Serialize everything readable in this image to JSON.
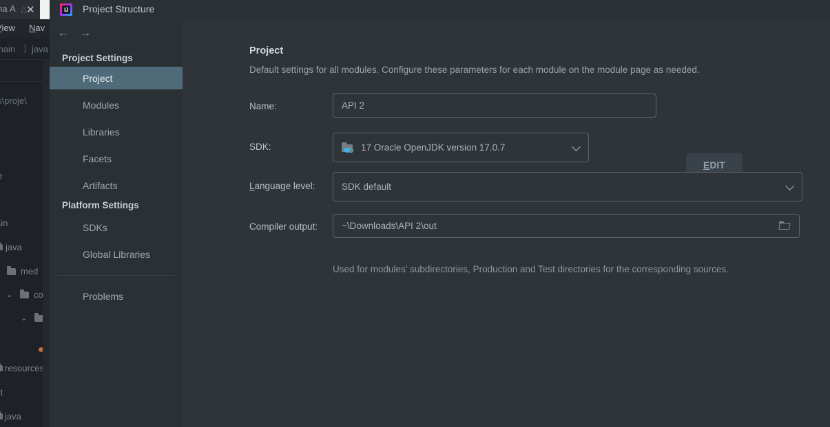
{
  "background_ide": {
    "tab_label": "na A",
    "tab_warning_icon": "warning-icon",
    "tab_close_icon": "close-icon",
    "menu": [
      {
        "label": "View",
        "mnemonic": "V"
      },
      {
        "label": "Nav",
        "mnemonic": "N"
      }
    ],
    "breadcrumb": [
      "main",
      "java"
    ],
    "breadcrumb_separator": "〉",
    "path_text": "sers\\proje\\",
    "tree": [
      {
        "label": "e",
        "indent": 0,
        "chevron": "",
        "folder": false
      },
      {
        "label": "ain",
        "indent": 0,
        "chevron": "",
        "folder": false
      },
      {
        "label": "java",
        "indent": 0,
        "chevron": "",
        "folder": true
      },
      {
        "label": "med",
        "indent": 1,
        "chevron": "",
        "folder": true
      },
      {
        "label": "com",
        "indent": 1,
        "chevron": "⌄",
        "folder": true
      },
      {
        "label": "",
        "indent": 2,
        "chevron": "⌄",
        "folder": true
      },
      {
        "label": "resources",
        "indent": 0,
        "chevron": "",
        "folder": true
      },
      {
        "label": "st",
        "indent": 0,
        "chevron": "",
        "folder": false
      },
      {
        "label": "java",
        "indent": 0,
        "chevron": "",
        "folder": true
      }
    ]
  },
  "dialog": {
    "title": "Project Structure",
    "logo_icon": "intellij-idea-logo-icon",
    "logo_text": "IJ",
    "nav": {
      "back_icon": "arrow-left-icon",
      "forward_icon": "arrow-right-icon"
    },
    "sidebar": {
      "groups": [
        {
          "label": "Project Settings",
          "items": [
            {
              "label": "Project",
              "selected": true
            },
            {
              "label": "Modules",
              "selected": false
            },
            {
              "label": "Libraries",
              "selected": false
            },
            {
              "label": "Facets",
              "selected": false
            },
            {
              "label": "Artifacts",
              "selected": false
            }
          ]
        },
        {
          "label": "Platform Settings",
          "items": [
            {
              "label": "SDKs",
              "selected": false
            },
            {
              "label": "Global Libraries",
              "selected": false
            }
          ]
        }
      ],
      "extra_items": [
        {
          "label": "Problems",
          "selected": false
        }
      ]
    },
    "main": {
      "heading": "Project",
      "description": "Default settings for all modules. Configure these parameters for each module on the module page as needed.",
      "fields": {
        "name": {
          "label": "Name:",
          "value": "API 2"
        },
        "sdk": {
          "label": "SDK:",
          "value": "17 Oracle OpenJDK version 17.0.7",
          "icon": "jdk-folder-icon",
          "chevron_icon": "chevron-down-icon",
          "edit_button": {
            "label": "EDIT",
            "mnemonic": "E"
          }
        },
        "language_level": {
          "label": "Language level:",
          "mnemonic": "L",
          "value": "SDK default",
          "chevron_icon": "chevron-down-icon"
        },
        "compiler_output": {
          "label": "Compiler output:",
          "value": "~\\Downloads\\API 2\\out",
          "browse_icon": "folder-browse-icon",
          "hint": "Used for modules' subdirectories, Production and Test directories for the corresponding sources."
        }
      }
    }
  },
  "colors": {
    "dialog_bg": "#2b3034",
    "main_bg": "#2f3438",
    "selection": "#4f6b7a",
    "accent_java": "#43b1d8",
    "text_primary": "#c8ced4",
    "text_secondary": "#9aa3ab",
    "field_border": "#5a6670"
  }
}
